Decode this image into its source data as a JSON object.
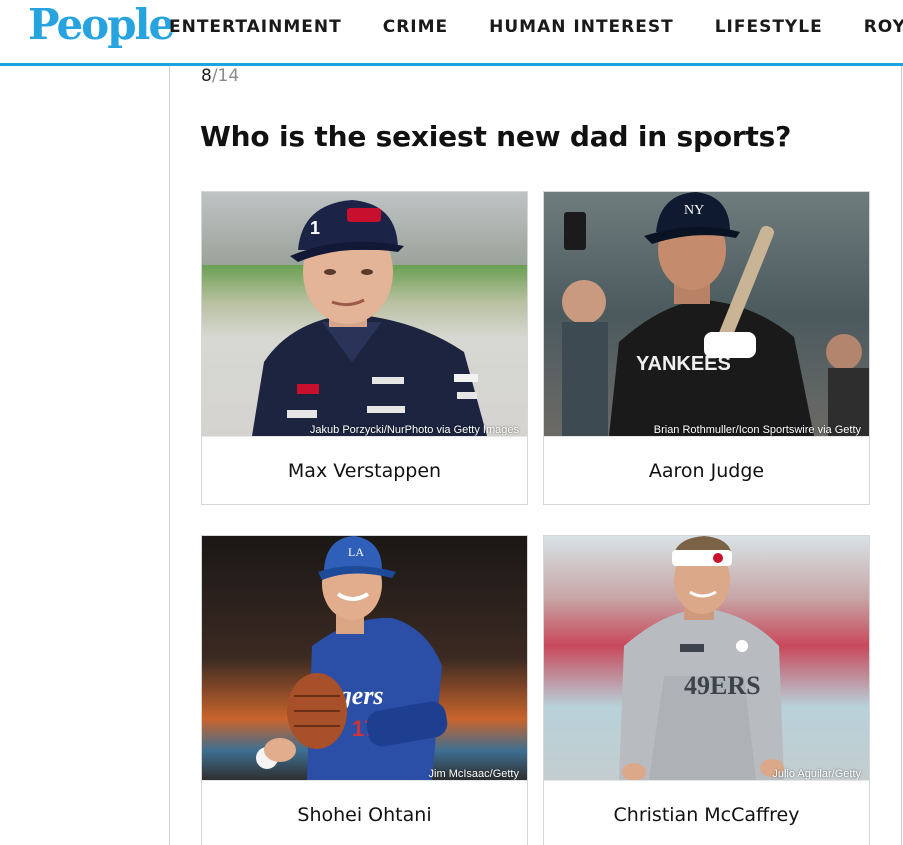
{
  "header": {
    "logo": "People",
    "nav": [
      "ENTERTAINMENT",
      "CRIME",
      "HUMAN INTEREST",
      "LIFESTYLE",
      "ROYALS"
    ]
  },
  "gallery": {
    "current": "8",
    "total": "/14",
    "question": "Who is the sexiest new dad in sports?"
  },
  "cards": [
    {
      "name": "Max Verstappen",
      "credit": "Jakub Porzycki/NurPhoto via Getty Images"
    },
    {
      "name": "Aaron Judge",
      "credit": "Brian Rothmuller/Icon Sportswire via Getty"
    },
    {
      "name": "Shohei Ohtani",
      "credit": "Jim McIsaac/Getty"
    },
    {
      "name": "Christian McCaffrey",
      "credit": "Julio Aguilar/Getty"
    }
  ],
  "colors": {
    "brand": "#27a4e0",
    "header_rule": "#1aa3e0"
  }
}
